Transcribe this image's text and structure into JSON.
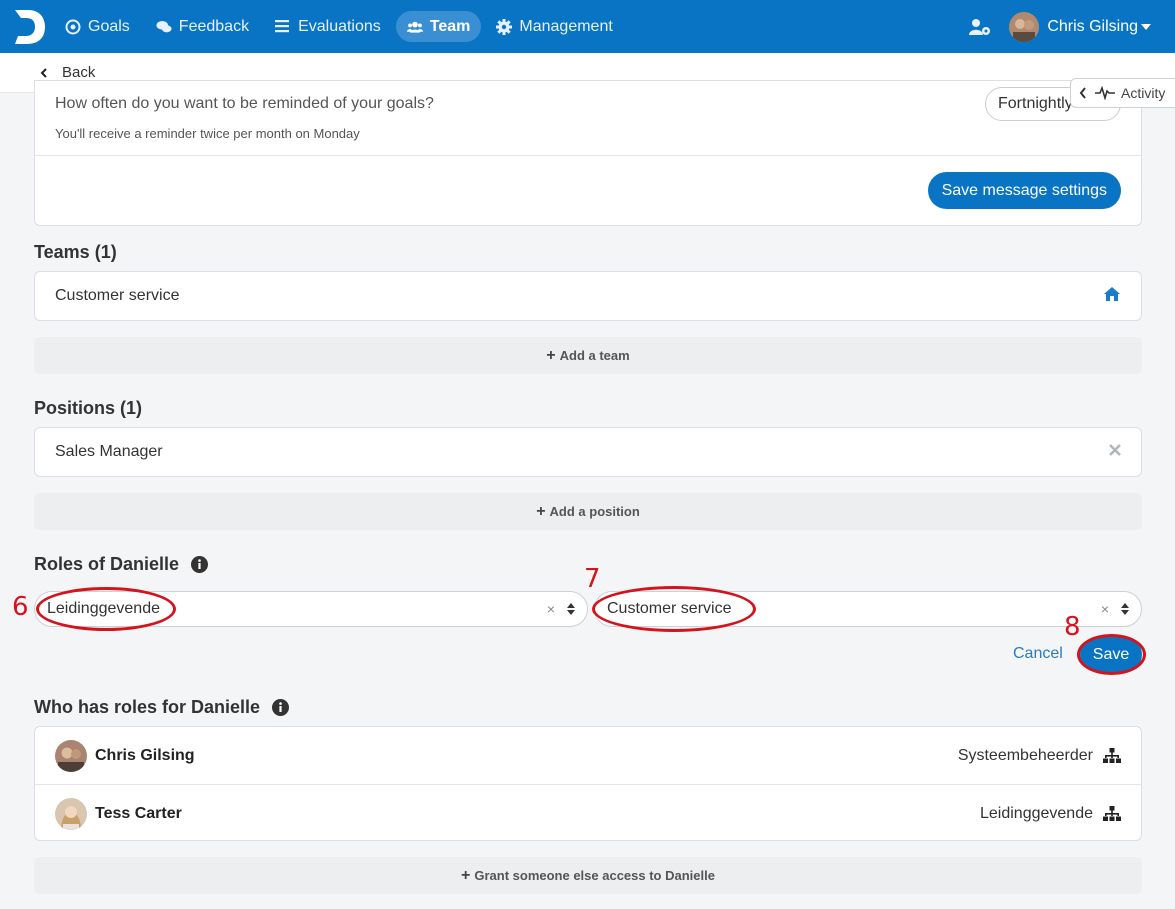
{
  "nav": {
    "items": [
      {
        "label": "Goals",
        "icon": "target-icon"
      },
      {
        "label": "Feedback",
        "icon": "comments-icon"
      },
      {
        "label": "Evaluations",
        "icon": "list-icon"
      },
      {
        "label": "Team",
        "icon": "users-icon",
        "active": true
      },
      {
        "label": "Management",
        "icon": "gear-icon"
      }
    ],
    "user_name": "Chris Gilsing"
  },
  "subbar": {
    "back_label": "Back"
  },
  "activity": {
    "label": "Activity"
  },
  "messages": {
    "question": "How often do you want to be reminded of your goals?",
    "subtitle": "You'll receive a reminder twice per month on Monday",
    "frequency_value": "Fortnightly",
    "save_label": "Save message settings"
  },
  "teams": {
    "title": "Teams (1)",
    "items": [
      "Customer service"
    ],
    "add_label": "Add a team"
  },
  "positions": {
    "title": "Positions (1)",
    "items": [
      "Sales Manager"
    ],
    "add_label": "Add a position"
  },
  "roles": {
    "title": "Roles of Danielle",
    "role_value": "Leidinggevende",
    "team_value": "Customer service",
    "clear_glyph": "×",
    "cancel_label": "Cancel",
    "save_label": "Save"
  },
  "who_has_roles": {
    "title": "Who has roles for Danielle",
    "people": [
      {
        "name": "Chris Gilsing",
        "role": "Systeembeheerder"
      },
      {
        "name": "Tess Carter",
        "role": "Leidinggevende"
      }
    ],
    "grant_label": "Grant someone else access to Danielle"
  },
  "annotations": [
    "6",
    "7",
    "8"
  ],
  "colors": {
    "primary": "#0a74c4",
    "annotation": "#d4141c"
  }
}
